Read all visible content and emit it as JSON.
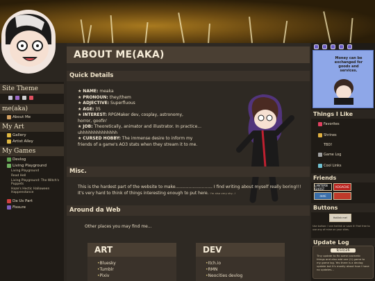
{
  "page": {
    "title": "ABOUT ME(AKA)"
  },
  "left_sidebar": {
    "site_theme": "Site Theme",
    "me_section": "me(aka)",
    "me_items": [
      {
        "label": "About Me"
      }
    ],
    "my_art": "My Art",
    "art_items": [
      {
        "label": "Gallery"
      },
      {
        "label": "Artist Alley"
      }
    ],
    "my_games": "My Games",
    "devlog": "Devlog",
    "living_playground": "Living Playground",
    "living_sub": [
      "Living Playground",
      "Read Hell",
      "Living Playground: The Witch's Puppets",
      "Haze's Hectic Halloween Happenstance"
    ],
    "da_us_part": "Da Us Part",
    "fissure": "Fissure"
  },
  "quick_details": {
    "heading": "Quick Details",
    "items": [
      {
        "key": "NAME:",
        "value": "meaka"
      },
      {
        "key": "PRONOUN:",
        "value": "they/them"
      },
      {
        "key": "ADJECTIVE:",
        "value": "Superfluous"
      },
      {
        "key": "AGE:",
        "value": "35"
      },
      {
        "key": "INTEREST:",
        "value": "RPGMaker dev, cosplay, astronomy,"
      },
      {
        "key": "",
        "value": "horror, goofin'"
      },
      {
        "key": "JOB:",
        "value": "Theoretically, animator and illustrator. In practice..."
      },
      {
        "key": "",
        "value": "uhhhhhhhhhhhhhh"
      },
      {
        "key": "CURSED HOBBY:",
        "value": "The immense desire to inform my"
      },
      {
        "key": "",
        "value": "friends of a game's AO3 stats when they stream it to me."
      }
    ]
  },
  "misc": {
    "heading": "Misc.",
    "text": "This is the hardest part of the website to make............................ I find writing about myself really boring!!! It's very hard to think of things interesting enough to put here.",
    "aside": "I'm also very shy...!"
  },
  "around": {
    "heading": "Around da Web",
    "text": "Other places you may find me..."
  },
  "art_card": {
    "title": "ART",
    "links": [
      "Bluesky",
      "Tumblr",
      "Pixiv"
    ]
  },
  "dev_card": {
    "title": "DEV",
    "links": [
      "Itch.io",
      "RMN",
      "Neocities devlog"
    ]
  },
  "right_sidebar": {
    "money_text": "Money can be exchanged for goods and services.",
    "things_i_like": "Things I Like",
    "like_items": [
      {
        "label": "Favorites"
      },
      {
        "label": "Shrines"
      },
      {
        "label": "TBD!"
      },
      {
        "label": "Game Log"
      },
      {
        "label": "Cool Links"
      }
    ],
    "friends": "Friends",
    "friend_buttons": [
      {
        "label": "LANTERN GHOST",
        "color": "#1a1a1a"
      },
      {
        "label": "KOGACHE",
        "color": "#b8211c"
      },
      {
        "label": "remi",
        "color": "#3a6ea8"
      },
      {
        "label": "",
        "color": "#c03a2a"
      }
    ],
    "buttons": "Buttons",
    "button_caption": "Hotlink me!",
    "buttons_note": "Use button: I can hotlink or save it! Feel free to use any of mine on your sites.",
    "update_log": "Update Log",
    "update_date": "9/10/26",
    "update_text": "Tiny update to fix some cosmetic things and also add one (1) game to my game log. Yes there is a devlog update but it's mostly about how I have no updates..."
  },
  "colors": {
    "accent": "#d4c07a",
    "panel": "#3a322a",
    "title_bar": "#4a3f33"
  }
}
